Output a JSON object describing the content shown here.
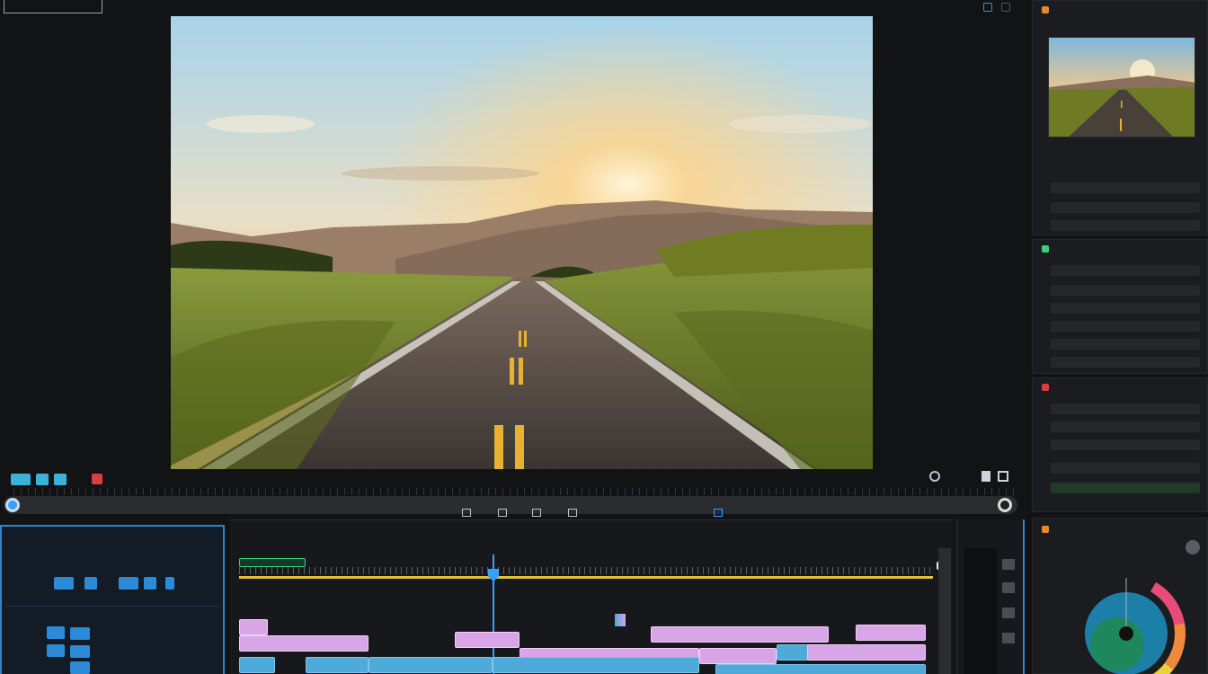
{
  "viewer": {
    "tag_label": ""
  },
  "right_top": {
    "title": "",
    "rows": [
      "",
      "",
      ""
    ]
  },
  "right_mid": {
    "title": "",
    "rows": [
      "",
      "",
      "",
      "",
      "",
      ""
    ]
  },
  "right_low": {
    "title": "",
    "rows": [
      "",
      "",
      "",
      "",
      ""
    ]
  },
  "color_panel": {
    "title": "",
    "subtitle": ""
  },
  "timeline": {
    "header": "",
    "markers": [
      "",
      "",
      "",
      "",
      ""
    ],
    "clips_row1": [
      "",
      "",
      ""
    ],
    "clips_row2": [
      "",
      "",
      "",
      "",
      "",
      ""
    ],
    "clips_row3": [
      "",
      "",
      "",
      "",
      ""
    ]
  },
  "project": {
    "title": "",
    "subtitle": "",
    "subtitle2": "",
    "items": [
      "",
      "",
      ""
    ]
  },
  "colors": {
    "accent": "#2c84cf",
    "clip_pink": "#d8a5e6",
    "clip_blue": "#4fa9d9",
    "playhead": "#3aa0ff",
    "marker_green": "#3bd37a",
    "work_area": "#e6c23a"
  }
}
